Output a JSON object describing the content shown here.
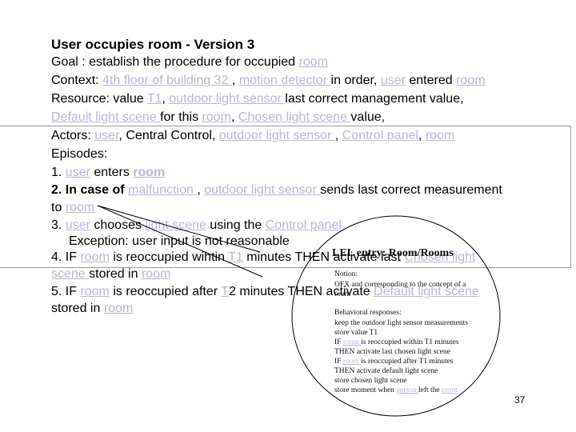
{
  "slide": {
    "title": "User occupies room - Version  3",
    "goal": {
      "label": "Goal : establish the procedure for occupied ",
      "link": "room"
    },
    "context": {
      "label": "Context: ",
      "l1": "4th floor of building 32 ",
      "t1": ", ",
      "l2": "motion detector ",
      "t2": "in order, ",
      "l3": "user",
      "t3": " entered ",
      "l4": "room"
    },
    "resource": {
      "label": "Resource: value ",
      "l1": "T1",
      "t1": ", ",
      "l2": "outdoor light sensor ",
      "t2": "last correct management value,",
      "l3": "Default light scene ",
      "t3": "for this ",
      "l4": "room",
      "t4": ", ",
      "l5": "Chosen light scene ",
      "t5": "value,"
    },
    "actors": {
      "label": "Actors: ",
      "l1": "user",
      "t1": ", Central Control, ",
      "l2": "outdoor light sensor ",
      "t2": ", ",
      "l3": "Control panel",
      "t3": ", ",
      "l4": "room"
    },
    "episodes_label": "Episodes:",
    "ep1": {
      "num": "1. ",
      "l1": "user",
      "t1": " enters ",
      "l2": "room"
    },
    "ep2": {
      "bold": "2. In case of ",
      "l1": "malfunction ",
      "t1": ", ",
      "l2": "outdoor light sensor ",
      "t2": "sends last correct measurement",
      "t3": "to ",
      "l3": "room"
    },
    "ep3": {
      "num": "3. ",
      "l1": "user",
      "t1": " chooses ",
      "l2": "light scene",
      "t2": " using the ",
      "l3": "Control panel",
      "exception": "Exception: user input is not reasonable"
    },
    "ep4": {
      "t1": "4. IF ",
      "l1": "room",
      "t2": " is reoccupied wihtin ",
      "l2": "T1",
      "t3": " minutes THEN activate last ",
      "l3": "Chosen light",
      "l4": "scene ",
      "t4": "stored in ",
      "l5": "room"
    },
    "ep5": {
      "t1": "5. IF ",
      "l1": "room",
      "t2": " is reoccupied after ",
      "l2": "T",
      "t3": "2 minutes THEN activate ",
      "l3": "Default light scene",
      "t4": "stored in ",
      "l4": "room"
    },
    "page_number": "37"
  },
  "lel_callout": {
    "title": "LEL entry: Room/Rooms",
    "notion_label": "Notion:",
    "notion_text": "OFX and corresponding to the concept of a",
    "notion_text2": "room",
    "behavioral_label": "Behavioral responses:",
    "responses": [
      {
        "text": "keep the outdoor light sensor measurements"
      },
      {
        "text": "store value T1"
      },
      {
        "pre": "IF ",
        "link": "room ",
        "post": "is reoccupied within T1 minutes"
      },
      {
        "text": "THEN activate last chosen light scene"
      },
      {
        "pre": "IF ",
        "link": "room ",
        "post": "is reoccupied after T1 minutes"
      },
      {
        "text": "THEN activate default light scene"
      },
      {
        "text": "store chosen light scene"
      },
      {
        "pre": "store moment when ",
        "link": "person ",
        "post": "left the ",
        "link2": "room"
      }
    ]
  },
  "colors": {
    "link": "#b7b7d8",
    "text": "#000000",
    "rule": "#9a9a9a"
  }
}
